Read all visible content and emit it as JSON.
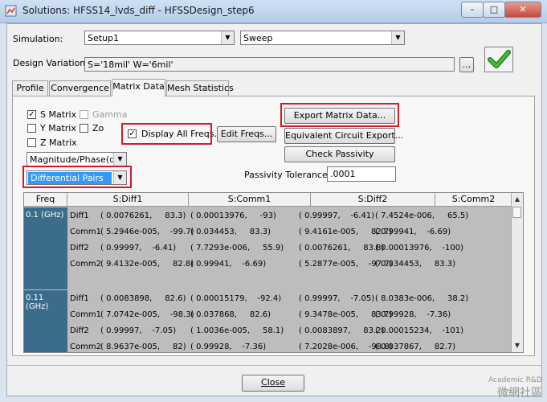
{
  "window": {
    "title": "Solutions: HFSS14_lvds_diff - HFSSDesign_step6",
    "buttons": {
      "minimize": "–",
      "maximize": "□",
      "close": "✕"
    }
  },
  "simulation": {
    "label": "Simulation:",
    "setup": "Setup1",
    "sweep": "Sweep"
  },
  "design_variation": {
    "label": "Design Variation:",
    "value": "S='18mil' W='6mil'",
    "browse": "..."
  },
  "tabs": [
    "Profile",
    "Convergence",
    "Matrix Data",
    "Mesh Statistics"
  ],
  "options": {
    "s_matrix": "S Matrix",
    "gamma": "Gamma",
    "y_matrix": "Y Matrix",
    "zo": "Zo",
    "z_matrix": "Z Matrix",
    "display_all_freqs": "Display All Freqs.",
    "edit_freqs": "Edit Freqs...",
    "format": "Magnitude/Phase(deg",
    "pairs": "Differential Pairs"
  },
  "actions": {
    "export_matrix": "Export Matrix Data...",
    "equivalent_circuit": "Equivalent Circuit Export...",
    "check_passivity": "Check Passivity"
  },
  "passivity": {
    "label": "Passivity Tolerance:",
    "value": ".0001"
  },
  "grid": {
    "columns": [
      "Freq",
      "S:Diff1",
      "S:Comm1",
      "S:Diff2",
      "S:Comm2"
    ],
    "groups": [
      {
        "freq": "0.1 (GHz)",
        "rows": [
          {
            "name": "Diff1",
            "cells": [
              "( 0.0076261,     83.3)",
              "( 0.00013976,     -93)",
              "( 0.99997,    -6.41)",
              "( 7.4524e-006,     65.5)"
            ]
          },
          {
            "name": "Comm1",
            "cells": [
              "( 5.2946e-005,    -99.7)",
              "( 0.034453,     83.3)",
              "( 9.4161e-005,     82.7)",
              "( 0.99941,    -6.69)"
            ]
          },
          {
            "name": "Diff2",
            "cells": [
              "( 0.99997,    -6.41)",
              "( 7.7293e-006,     55.9)",
              "( 0.0076261,     83.8)",
              "( 0.00013976,    -100)"
            ]
          },
          {
            "name": "Comm2",
            "cells": [
              "( 9.4132e-005,     82.8)",
              "( 0.99941,    -6.69)",
              "( 5.2877e-005,    -97.7)",
              "( 0.034453,     83.3)"
            ]
          }
        ]
      },
      {
        "freq": "0.11 (GHz)",
        "rows": [
          {
            "name": "Diff1",
            "cells": [
              "( 0.0083898,     82.6)",
              "( 0.00015179,    -92.4)",
              "( 0.99997,    -7.05)",
              "( 8.0383e-006,     38.2)"
            ]
          },
          {
            "name": "Comm1",
            "cells": [
              "( 7.0742e-005,    -98.3)",
              "( 0.037868,     82.6)",
              "( 9.3478e-005,     83.7)",
              "( 0.99928,    -7.36)"
            ]
          },
          {
            "name": "Diff2",
            "cells": [
              "( 0.99997,    -7.05)",
              "( 1.0036e-005,     58.1)",
              "( 0.0083897,     83.2)",
              "( 0.00015234,    -101)"
            ]
          },
          {
            "name": "Comm2",
            "cells": [
              "( 8.9637e-005,     82)",
              "( 0.99928,    -7.36)",
              "( 7.2028e-006,    -98.8)",
              "( 0.037867,     82.7)"
            ]
          }
        ]
      }
    ]
  },
  "footer": {
    "close": "Close"
  },
  "watermark": {
    "line1": "Academic R&D",
    "line2": "微網社區"
  },
  "colors": {
    "highlight": "#d01b2a",
    "freq_cell": "#3c6c8c",
    "selection": "#3399ff",
    "ok_check": "#2ca02c"
  }
}
